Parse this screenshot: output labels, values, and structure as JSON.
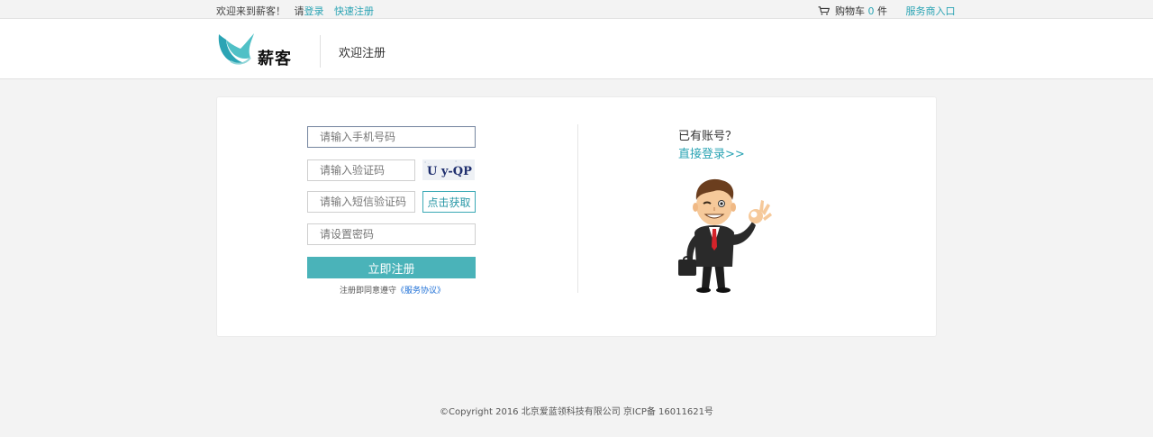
{
  "topbar": {
    "welcome": "欢迎来到薪客！",
    "please": "请",
    "login": "登录",
    "quick_register": "快速注册",
    "cart_label": "购物车",
    "cart_count": "0",
    "cart_unit": "件",
    "merchant_entry": "服务商入口"
  },
  "header": {
    "logo_text": "薪客",
    "title": "欢迎注册"
  },
  "form": {
    "phone_placeholder": "请输入手机号码",
    "captcha_placeholder": "请输入验证码",
    "captcha_image_text": "U y-QP",
    "sms_placeholder": "请输入短信验证码",
    "sms_button": "点击获取",
    "password_placeholder": "请设置密码",
    "submit": "立即注册",
    "agreement_prefix": "注册即同意遵守",
    "agreement_link": "《服务协议》"
  },
  "side": {
    "has_account": "已有账号？",
    "login_link": "直接登录>>"
  },
  "footer": {
    "copyright": "©Copyright 2016 北京爱蓝领科技有限公司 京ICP备 16011621号"
  },
  "colors": {
    "accent": "#2ba4b4",
    "button": "#4ab3b9",
    "link_blue": "#1d6fd6"
  },
  "icons": {
    "cart": "cart-icon",
    "logo": "bird-logo-icon",
    "mascot": "businessman-ok-illustration"
  }
}
